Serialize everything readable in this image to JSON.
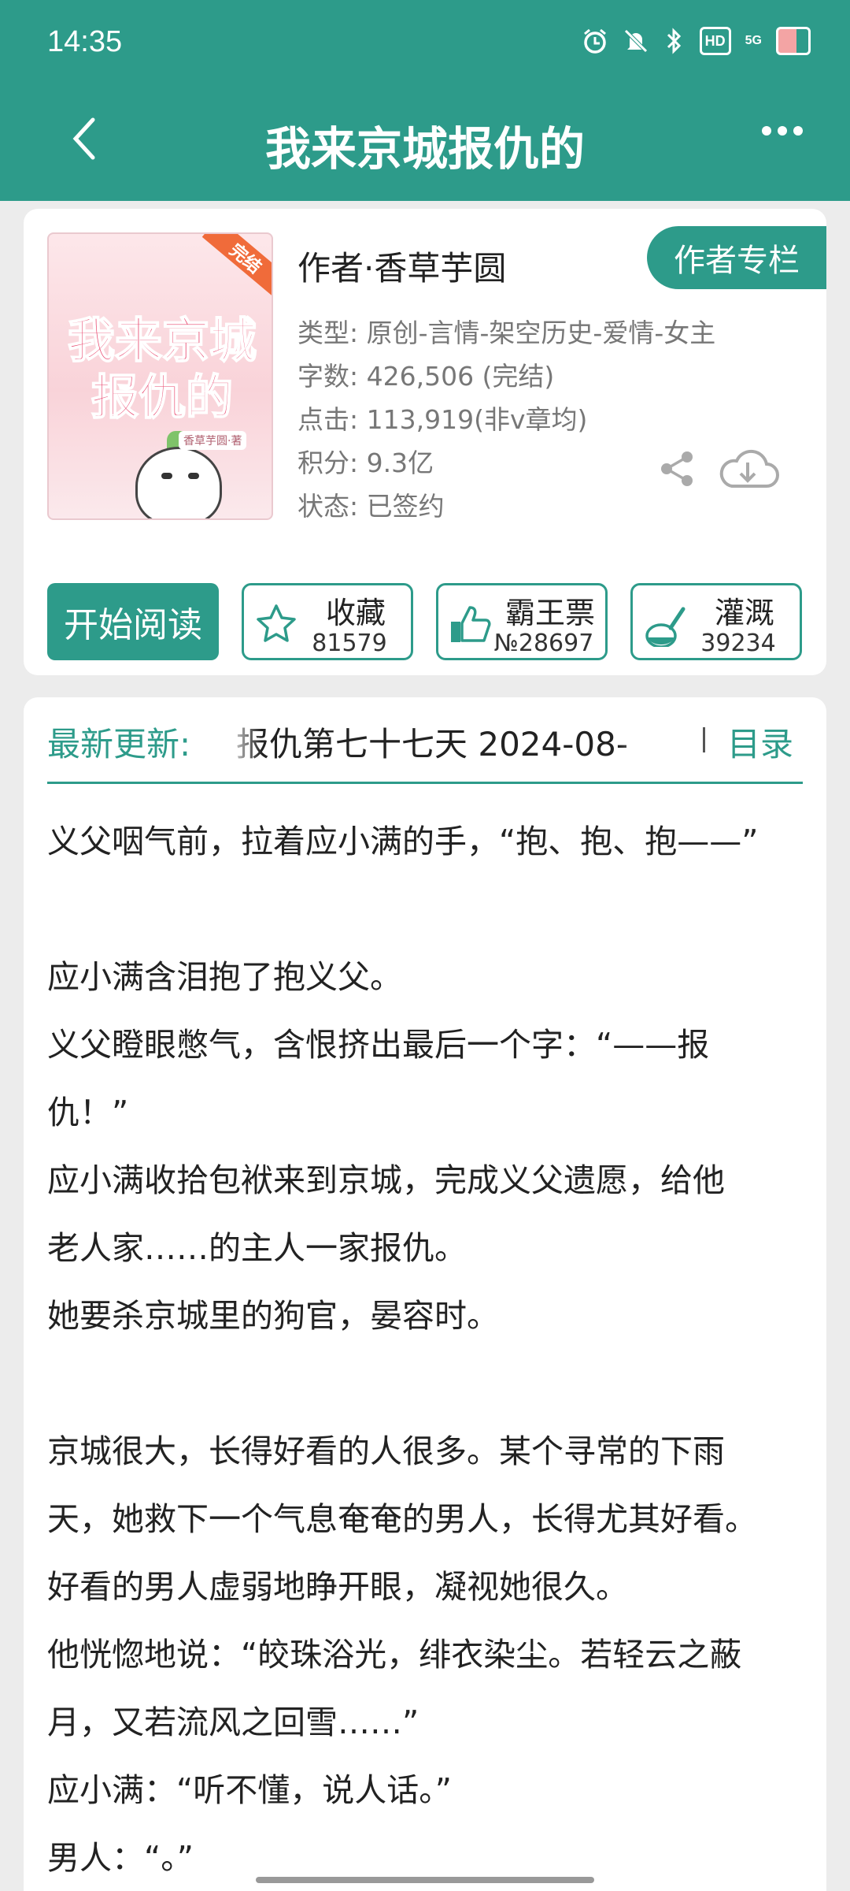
{
  "status_bar": {
    "time": "14:35",
    "hd": "HD",
    "network": "5G"
  },
  "nav": {
    "title": "我来京城报仇的"
  },
  "book": {
    "cover_title": "我来京城报仇的",
    "cover_ribbon": "完结",
    "cover_author": "香草芋圆·著",
    "author": "作者·香草芋圆",
    "author_column_label": "作者专栏",
    "meta": [
      "类型: 原创-言情-架空历史-爱情-女主",
      "字数: 426,506 (完结)",
      "点击: 113,919(非v章均)",
      "积分: 9.3亿",
      "状态: 已签约"
    ]
  },
  "actions": {
    "read_label": "开始阅读",
    "favorite": {
      "label": "收藏",
      "count": "81579"
    },
    "ticket": {
      "label": "霸王票",
      "count": "№28697"
    },
    "irrigate": {
      "label": "灌溉",
      "count": "39234"
    }
  },
  "update": {
    "label": "最新更新:",
    "text": "报仇第七十七天  2024-08-",
    "toc_label": "目录"
  },
  "chapter_paragraphs": [
    "义父咽气前，拉着应小满的手，“抱、抱、抱——”",
    "",
    "应小满含泪抱了抱义父。",
    "义父瞪眼憋气，含恨挤出最后一个字：“——报",
    "仇！”",
    "应小满收拾包袱来到京城，完成义父遗愿，给他",
    "老人家……的主人一家报仇。",
    "她要杀京城里的狗官，晏容时。",
    "",
    "京城很大，长得好看的人很多。某个寻常的下雨",
    "天，她救下一个气息奄奄的男人，长得尤其好看。",
    "好看的男人虚弱地睁开眼，凝视她很久。",
    "他恍惚地说：“皎珠浴光，绯衣染尘。若轻云之蔽",
    "月，又若流风之回雪……”",
    "应小满：“听不懂，说人话。”",
    "男人：“。”"
  ],
  "colors": {
    "accent": "#2d9b8a",
    "background": "#ececec"
  }
}
